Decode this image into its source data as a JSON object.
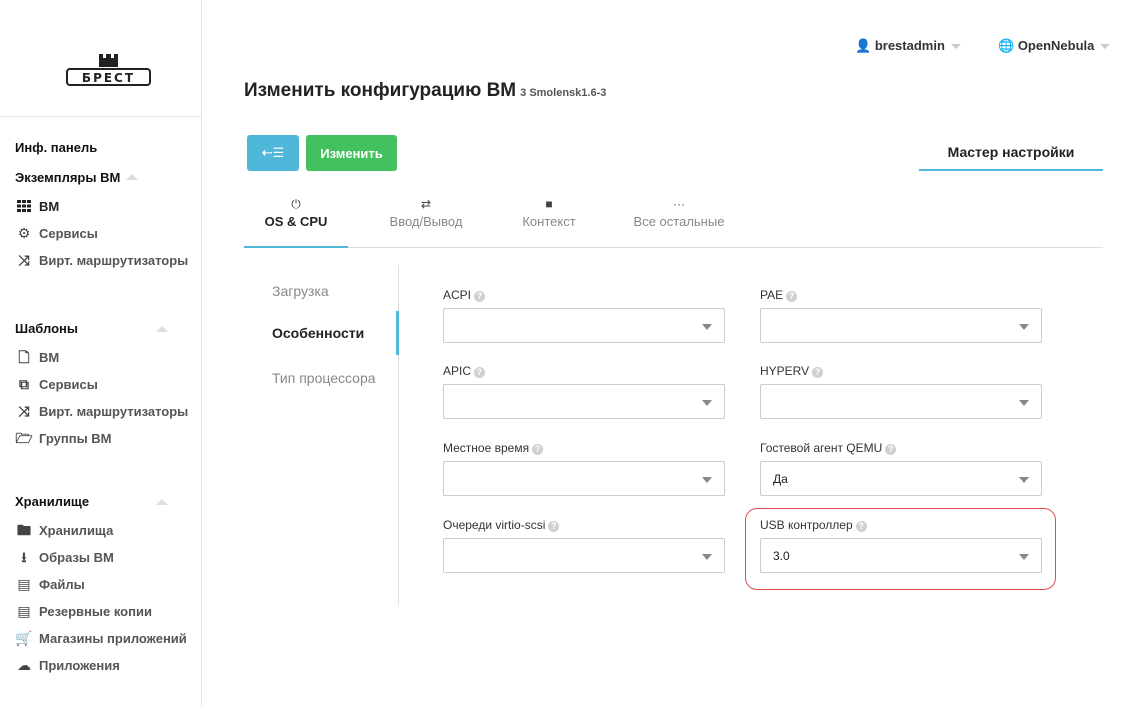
{
  "logo_text": "БРЕСТ",
  "header": {
    "title": "Изменить конфигурацию ВМ",
    "subtitle": "3 Smolensk1.6-3",
    "user": "brestadmin",
    "zone": "OpenNebula"
  },
  "sidebar": {
    "dashboard": "Инф. панель",
    "instances_title": "Экземпляры ВМ",
    "instances": [
      {
        "label": "ВМ",
        "icon": "grid-icon"
      },
      {
        "label": "Сервисы",
        "icon": "services-icon"
      },
      {
        "label": "Вирт. маршрутизаторы",
        "icon": "router-icon"
      }
    ],
    "templates_title": "Шаблоны",
    "templates": [
      {
        "label": "ВМ",
        "icon": "file-icon"
      },
      {
        "label": "Сервисы",
        "icon": "copy-icon"
      },
      {
        "label": "Вирт. маршрутизаторы",
        "icon": "router-icon"
      },
      {
        "label": "Группы ВМ",
        "icon": "folder-open-icon"
      }
    ],
    "storage_title": "Хранилище",
    "storage": [
      {
        "label": "Хранилища",
        "icon": "folder-icon"
      },
      {
        "label": "Образы ВМ",
        "icon": "download-icon"
      },
      {
        "label": "Файлы",
        "icon": "archive-icon"
      },
      {
        "label": "Резервные копии",
        "icon": "archive-icon"
      },
      {
        "label": "Магазины приложений",
        "icon": "cart-icon"
      },
      {
        "label": "Приложения",
        "icon": "cloud-icon"
      }
    ]
  },
  "toolbar": {
    "back_label": "⇠☰",
    "update_label": "Изменить",
    "wizard_label": "Мастер настройки"
  },
  "tabs": [
    {
      "label": "OS & CPU",
      "icon": "power-icon",
      "active": true
    },
    {
      "label": "Ввод/Вывод",
      "icon": "exchange-icon",
      "active": false
    },
    {
      "label": "Контекст",
      "icon": "folder-icon",
      "active": false
    },
    {
      "label": "Все остальные",
      "icon": "ellipsis-icon",
      "active": false
    }
  ],
  "vtabs": [
    {
      "label": "Загрузка",
      "active": false
    },
    {
      "label": "Особенности",
      "active": true
    },
    {
      "label": "Тип процессора",
      "active": false
    }
  ],
  "fields": {
    "acpi": {
      "label": "ACPI",
      "value": ""
    },
    "pae": {
      "label": "PAE",
      "value": ""
    },
    "apic": {
      "label": "APIC",
      "value": ""
    },
    "hyperv": {
      "label": "HYPERV",
      "value": ""
    },
    "localtime": {
      "label": "Местное время",
      "value": ""
    },
    "guest_agent": {
      "label": "Гостевой агент QEMU",
      "value": "Да"
    },
    "virtio_queues": {
      "label": "Очереди virtio-scsi",
      "value": ""
    },
    "usb_controller": {
      "label": "USB контроллер",
      "value": "3.0"
    }
  },
  "colors": {
    "accent": "#4fb7d9",
    "success": "#43c15f",
    "highlight": "#e04c4c"
  }
}
